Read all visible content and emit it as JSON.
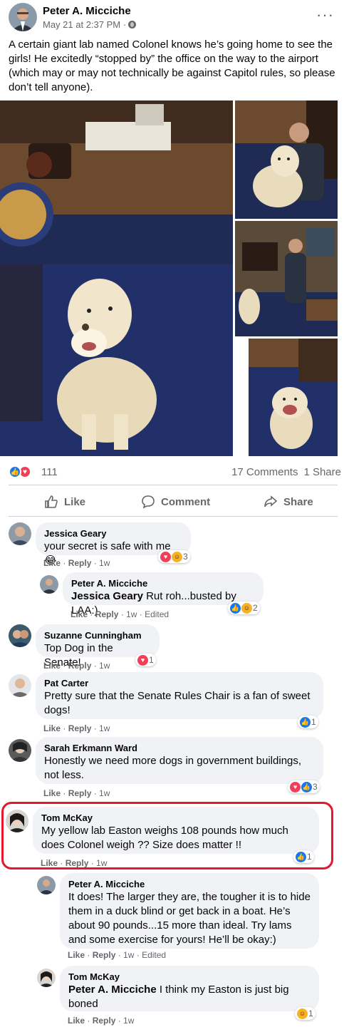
{
  "post": {
    "author": "Peter A. Micciche",
    "date": "May 21 at 2:37 PM · ",
    "privacy_icon": "globe-icon",
    "more_icon": "···",
    "text": "A certain giant lab named Colonel knows he’s going home to see the girls! He excitedly “stopped by” the office on the way to the airport (which may or may not technically be against Capitol rules, so please don’t tell anyone)."
  },
  "reactions": {
    "count": "111",
    "icons": [
      "like",
      "love"
    ]
  },
  "stats": {
    "comments": "17 Comments",
    "shares": "1 Share"
  },
  "actions": {
    "like": "Like",
    "comment": "Comment",
    "share": "Share"
  },
  "comments": [
    {
      "name": "Jessica Geary",
      "text": "your secret is safe with me 😂",
      "like": "Like",
      "reply": "Reply",
      "time": "1w",
      "edited": "",
      "reaction_count": "3",
      "reactions": [
        "love",
        "haha"
      ]
    },
    {
      "name": "Peter A. Micciche",
      "mention": "Jessica Geary",
      "text": " Rut roh...busted by LAA:)",
      "like": "Like",
      "reply": "Reply",
      "time": "1w",
      "edited": "Edited",
      "reaction_count": "2",
      "reactions": [
        "like",
        "haha"
      ]
    },
    {
      "name": "Suzanne Cunningham",
      "text": "Top Dog in the Senate!",
      "like": "Like",
      "reply": "Reply",
      "time": "1w",
      "edited": "",
      "reaction_count": "1",
      "reactions": [
        "love"
      ]
    },
    {
      "name": "Pat Carter",
      "text": "Pretty sure that the Senate Rules Chair is a fan of sweet dogs!",
      "like": "Like",
      "reply": "Reply",
      "time": "1w",
      "edited": "",
      "reaction_count": "1",
      "reactions": [
        "like"
      ]
    },
    {
      "name": "Sarah Erkmann Ward",
      "text": "Honestly we need more dogs in government buildings, not less.",
      "like": "Like",
      "reply": "Reply",
      "time": "1w",
      "edited": "",
      "reaction_count": "3",
      "reactions": [
        "love",
        "like"
      ]
    },
    {
      "name": "Tom McKay",
      "text": "My yellow lab Easton weighs 108 pounds how much does Colonel weigh ?? Size does matter !!",
      "like": "Like",
      "reply": "Reply",
      "time": "1w",
      "edited": "",
      "reaction_count": "1",
      "reactions": [
        "like"
      ]
    },
    {
      "name": "Peter A. Micciche",
      "text": "It does! The larger they are, the tougher it is to hide them in a duck blind or get back in a boat. He’s about 90 pounds...15 more than ideal. Try lams and some exercise for yours! He’ll be okay:)",
      "like": "Like",
      "reply": "Reply",
      "time": "1w",
      "edited": "Edited",
      "reaction_count": "",
      "reactions": []
    },
    {
      "name": "Tom McKay",
      "mention": "Peter A. Micciche",
      "text": " I think my Easton is just big boned",
      "like": "Like",
      "reply": "Reply",
      "time": "1w",
      "edited": "",
      "reaction_count": "1",
      "reactions": [
        "haha"
      ]
    }
  ],
  "colors": {
    "accent": "#1877f2",
    "love": "#f33e58",
    "highlight": "#e4182d",
    "bubble": "#f0f2f5",
    "meta": "#65676b"
  }
}
